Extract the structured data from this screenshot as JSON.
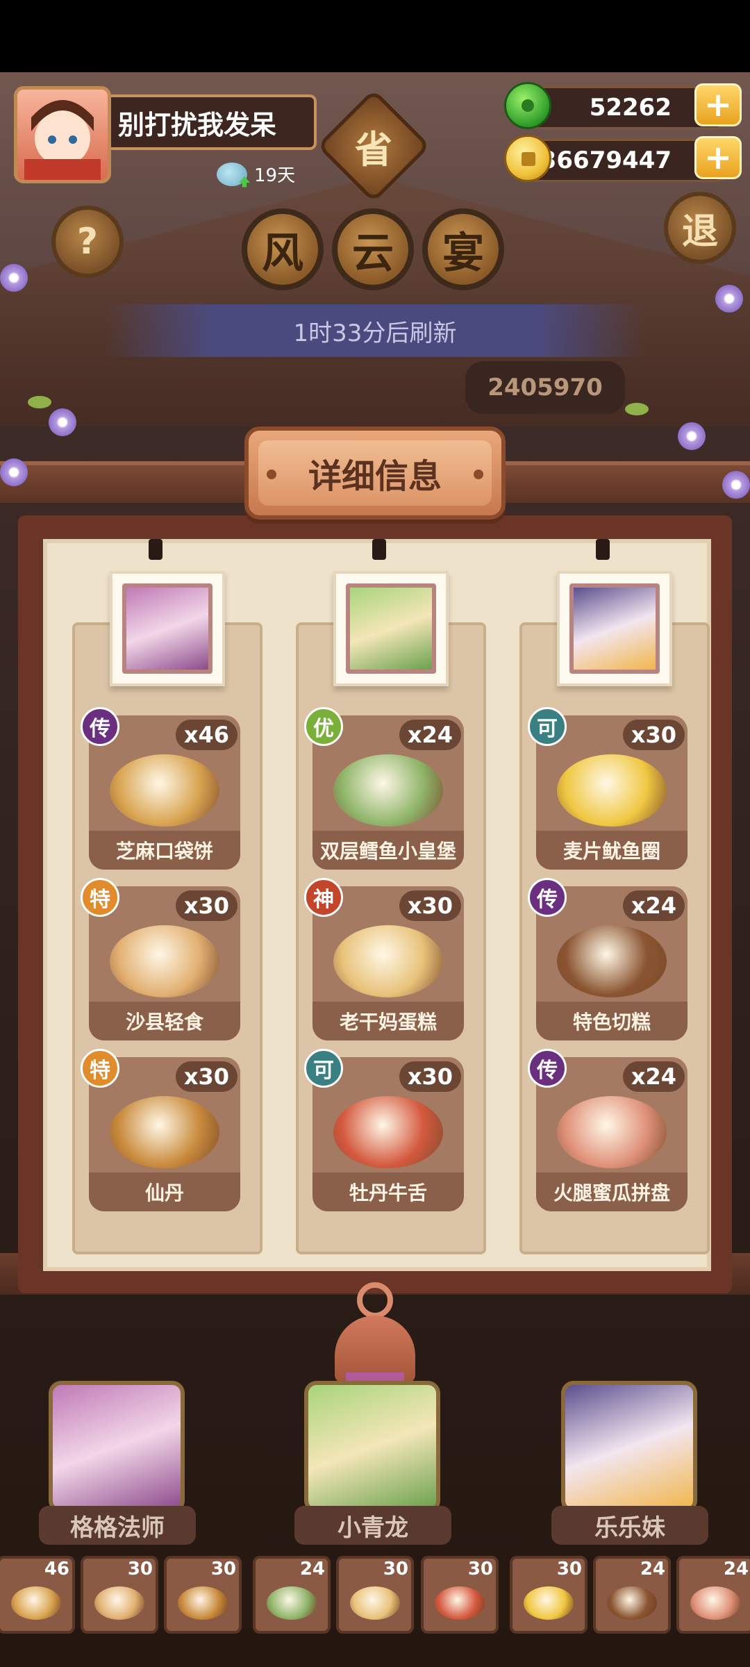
{
  "player": {
    "name": "别打扰我发呆",
    "days_label": "19天"
  },
  "currencies": {
    "jade": "52262",
    "gold": "36679447"
  },
  "province_label": "省",
  "title_chars": [
    "风",
    "云",
    "宴"
  ],
  "help_label": "?",
  "exit_label": "退",
  "refresh_text": "1时33分后刷新",
  "score_text": "2405970",
  "panel_title": "详细信息",
  "columns": [
    {
      "dishes": [
        {
          "name": "芝麻口袋饼",
          "count": "x46",
          "rarity": "传",
          "color": "#d9a451"
        },
        {
          "name": "沙县轻食",
          "count": "x30",
          "rarity": "特",
          "color": "#e2b072"
        },
        {
          "name": "仙丹",
          "count": "x30",
          "rarity": "特",
          "color": "#c98a3c"
        }
      ]
    },
    {
      "dishes": [
        {
          "name": "双层鳕鱼小皇堡",
          "count": "x24",
          "rarity": "优",
          "color": "#8fb56a"
        },
        {
          "name": "老干妈蛋糕",
          "count": "x30",
          "rarity": "神",
          "color": "#e8c27a"
        },
        {
          "name": "牡丹牛舌",
          "count": "x30",
          "rarity": "可",
          "color": "#d4593f"
        }
      ]
    },
    {
      "dishes": [
        {
          "name": "麦片鱿鱼圈",
          "count": "x30",
          "rarity": "可",
          "color": "#f0c842"
        },
        {
          "name": "特色切糕",
          "count": "x24",
          "rarity": "传",
          "color": "#8a5431"
        },
        {
          "name": "火腿蜜瓜拼盘",
          "count": "x24",
          "rarity": "传",
          "color": "#e0917a"
        }
      ]
    }
  ],
  "characters": [
    "格格法师",
    "小青龙",
    "乐乐妹"
  ],
  "inventory": [
    {
      "count": "46",
      "color": "#d9a451"
    },
    {
      "count": "30",
      "color": "#e2b072"
    },
    {
      "count": "30",
      "color": "#c98a3c"
    },
    {
      "count": "24",
      "color": "#8fb56a"
    },
    {
      "count": "30",
      "color": "#e8c27a"
    },
    {
      "count": "30",
      "color": "#d4593f"
    },
    {
      "count": "30",
      "color": "#f0c842"
    },
    {
      "count": "24",
      "color": "#8a5431"
    },
    {
      "count": "24",
      "color": "#e0917a"
    }
  ]
}
